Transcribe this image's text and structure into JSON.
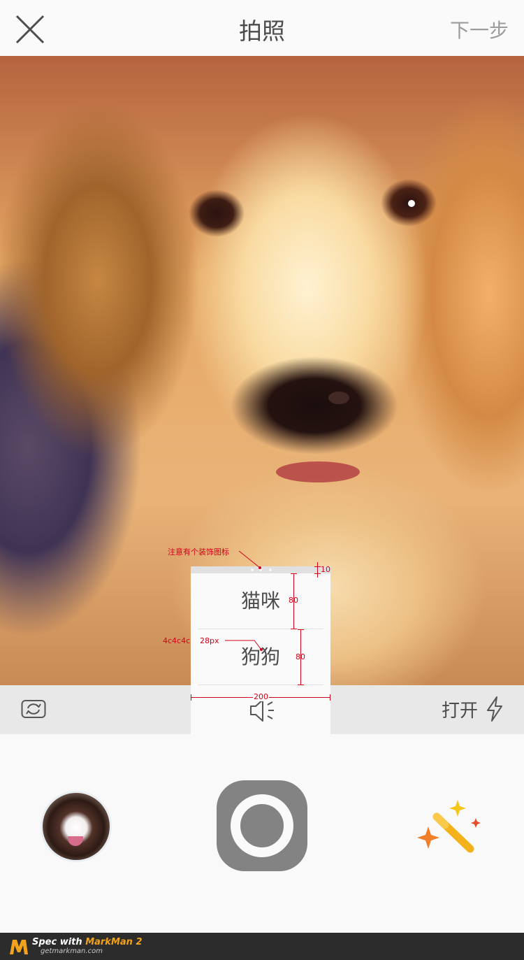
{
  "topbar": {
    "close_icon": "close-icon",
    "title": "拍照",
    "next_label": "下一步"
  },
  "photo": {
    "subject": "dog-photo"
  },
  "category_menu": {
    "options": [
      "猫咪",
      "狗狗"
    ],
    "text_color": "#4c4c4c",
    "mute_icon": "speaker-mute-icon"
  },
  "camera_bar": {
    "switch_icon": "camera-switch-icon",
    "flash_label": "打开",
    "flash_icon": "lightning-icon"
  },
  "bottom": {
    "album_icon": "album-thumbnail",
    "shutter_icon": "shutter-button",
    "magic_icon": "magic-wand-icon"
  },
  "annotations": {
    "decoration_note": "注意有个装饰图标",
    "top_gap": "10",
    "row1_height": "80",
    "row2_height": "80",
    "text_style_color": "4c4c4c",
    "text_style_size": "28px",
    "width": "200"
  },
  "footer": {
    "line1_prefix": "Spec with ",
    "line1_brand": "MarkMan 2",
    "line2": "getmarkman.com"
  },
  "colors": {
    "text": "#4c4c4c",
    "muted": "#9c9c9c",
    "bar": "#e8e8e8",
    "shutter": "#838383",
    "annotation": "#d0021b"
  }
}
